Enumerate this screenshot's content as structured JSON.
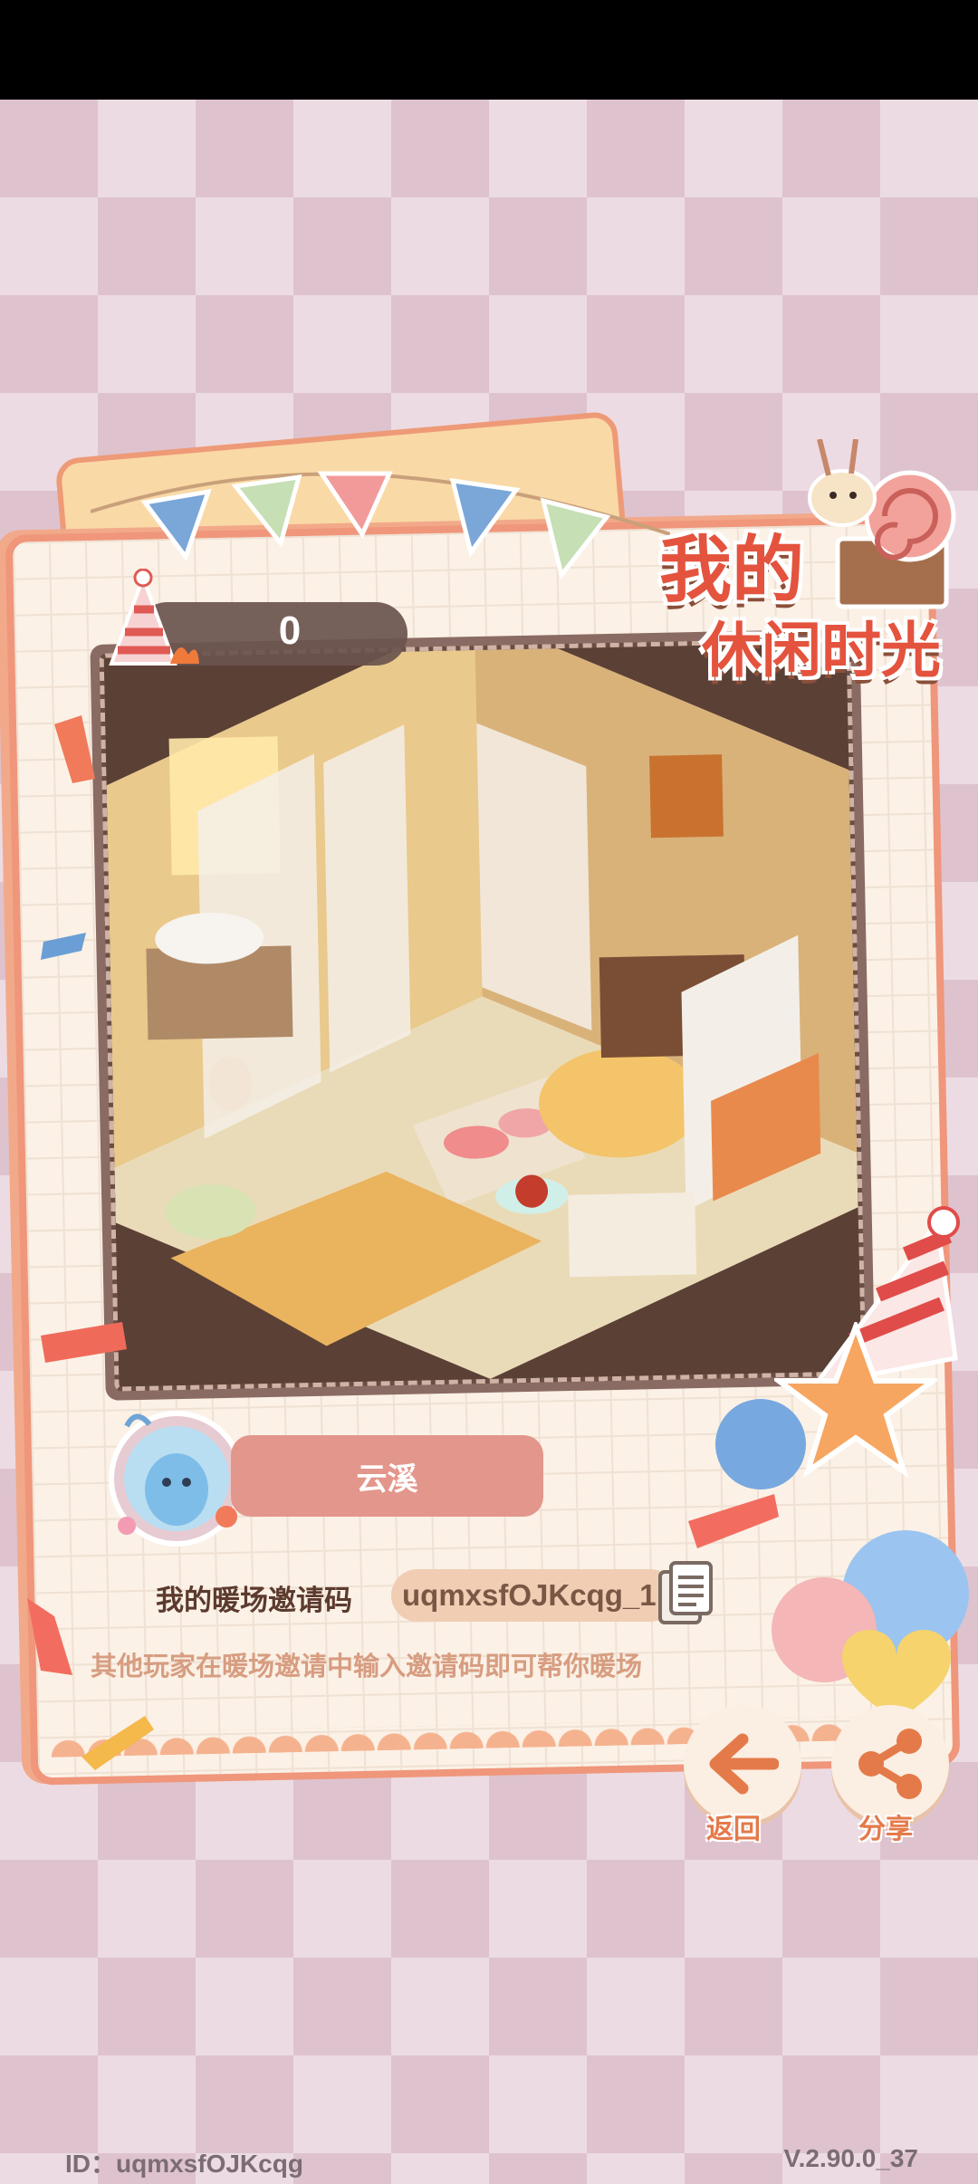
{
  "game": {
    "title_line1": "我的",
    "title_line2": "休闲时光",
    "score": "0",
    "player_name": "云溪",
    "invite_label": "我的暖场邀请码",
    "invite_code": "uqmxsfOJKcqg_1",
    "hint": "其他玩家在暖场邀请中输入邀请码即可帮你暖场",
    "back_label": "返回",
    "share_label": "分享"
  },
  "footer": {
    "id_text": "ID：uqmxsfOJKcqg",
    "version": "V.2.90.0_37"
  },
  "colors": {
    "accent": "#e47a4a",
    "card_border": "#ef967b",
    "name_pill": "#e3968b",
    "background_check": "#dec3cf"
  },
  "icons": [
    "party-hat-icon",
    "copy-icon",
    "back-arrow-icon",
    "share-icon",
    "snail-icon"
  ]
}
